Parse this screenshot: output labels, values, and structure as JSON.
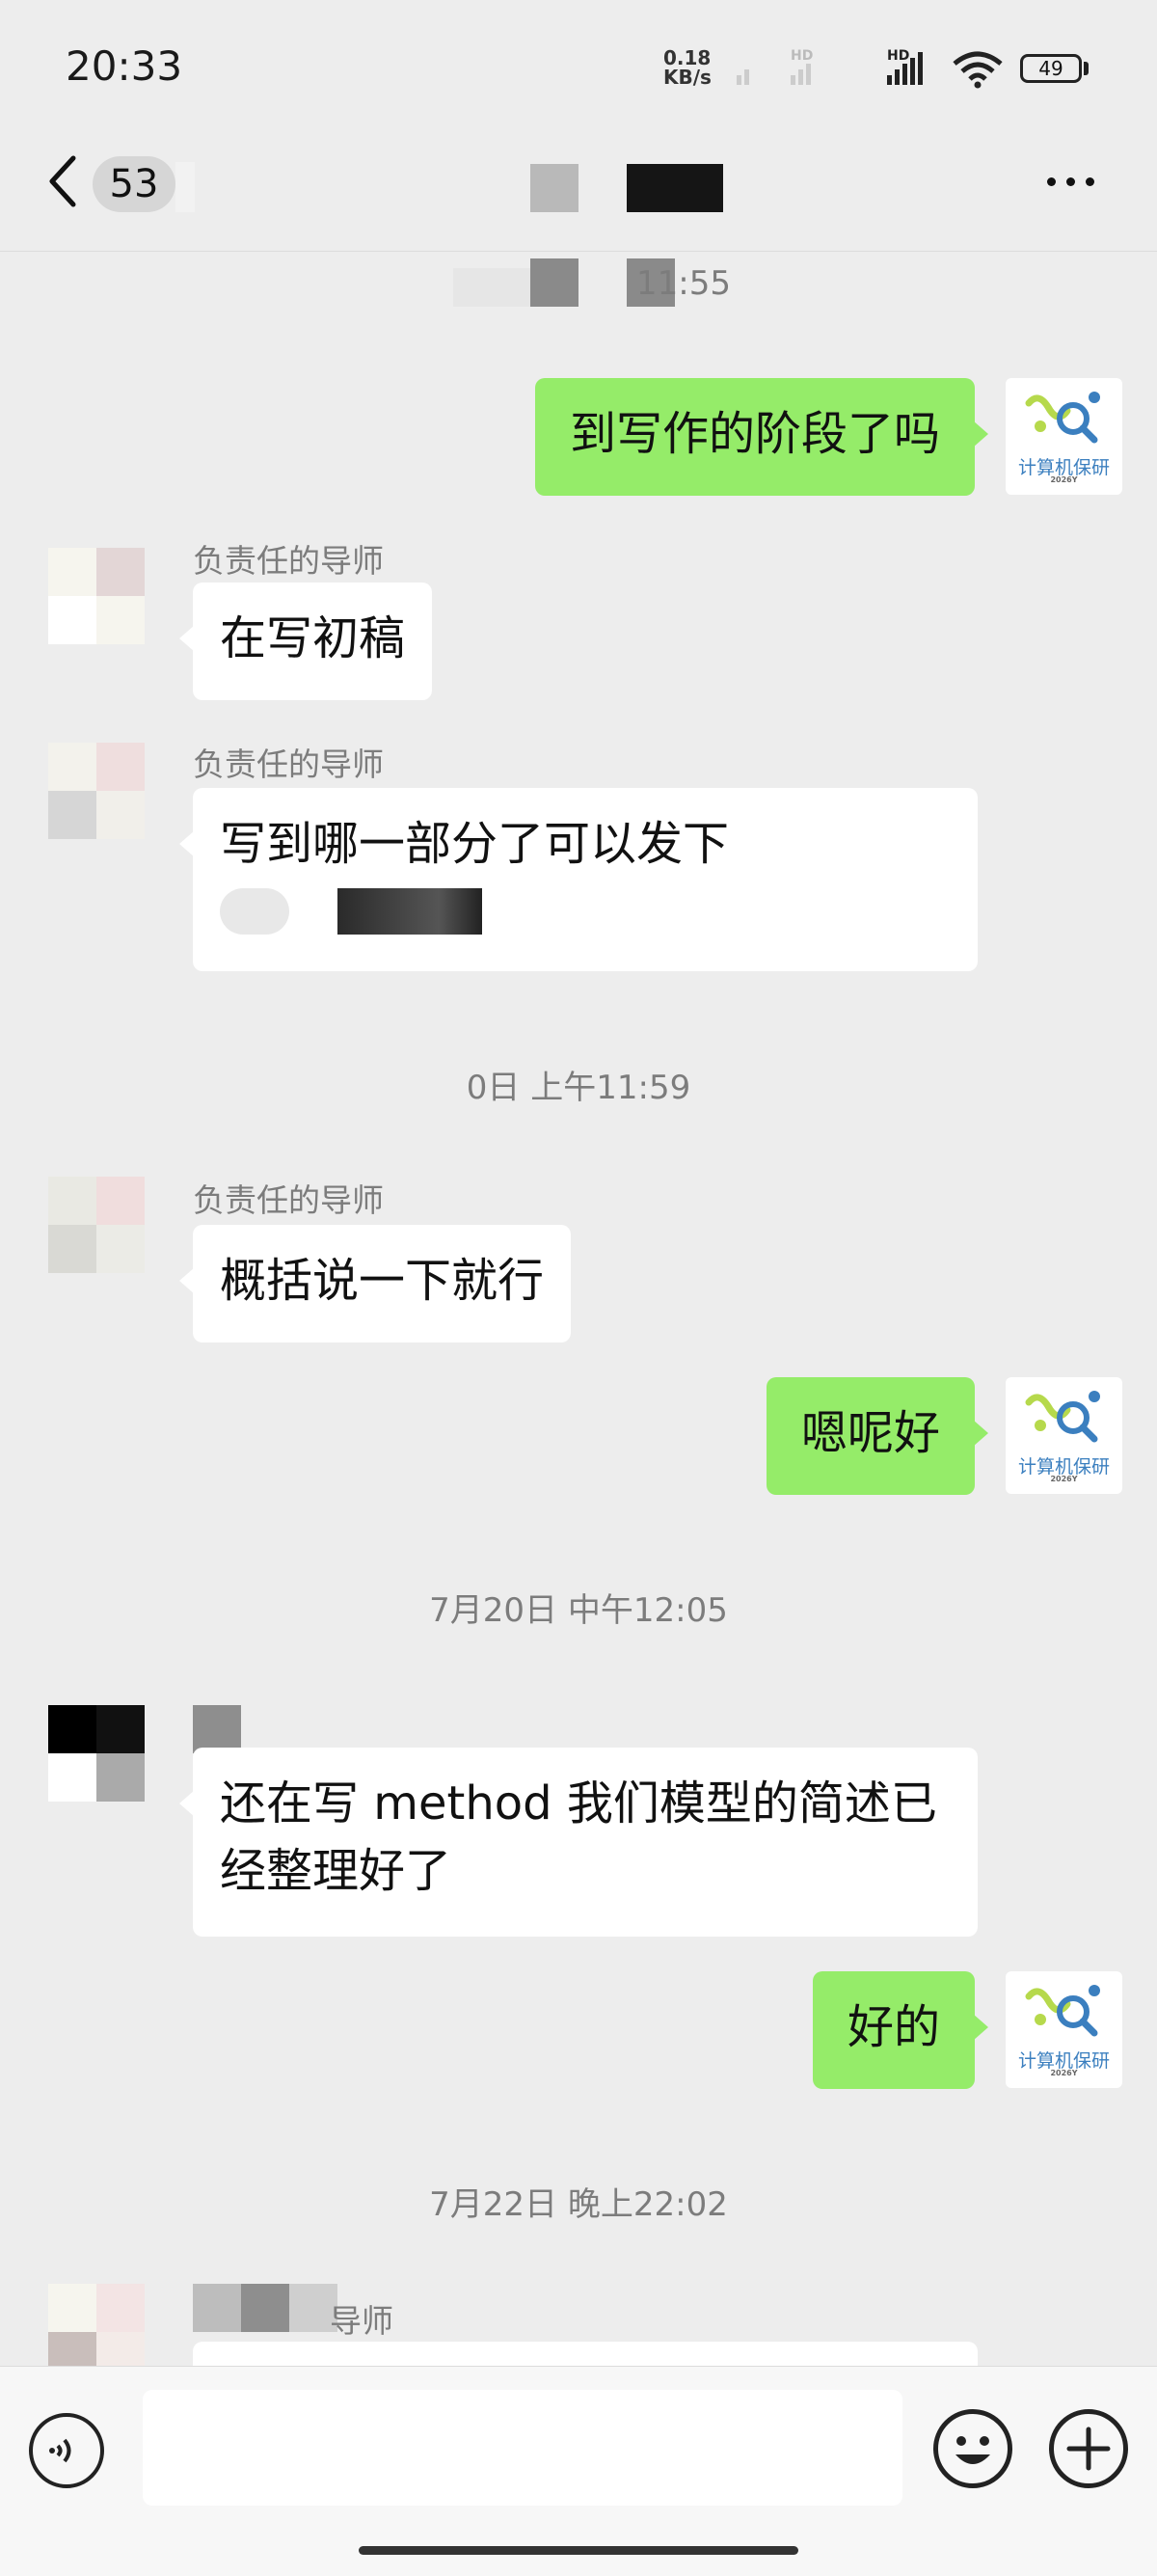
{
  "status_bar": {
    "time": "20:33",
    "net_speed_value": "0.18",
    "net_speed_unit": "KB/s",
    "hd1": "HD",
    "hd2": "HD",
    "battery": "49"
  },
  "nav": {
    "unread_count": "53"
  },
  "messages": [
    {
      "time_partial": "11:55"
    },
    {
      "me": "到写作的阶段了吗"
    },
    {
      "sender": "负责任的导师",
      "text": "在写初稿"
    },
    {
      "sender": "负责任的导师",
      "text": "写到哪一部分了可以发下"
    },
    {
      "time_partial": "0日 上午11:59"
    },
    {
      "sender": "负责任的导师",
      "text": "概括说一下就行"
    },
    {
      "me": "嗯呢好"
    },
    {
      "time": "7月20日 中午12:05"
    },
    {
      "text_line1": "还在写 method 我们模型的简述已",
      "text_line2": "经整理好了"
    },
    {
      "me": "好的"
    },
    {
      "time": "7月22日 晚上22:02"
    },
    {
      "sender_partial": "导师"
    }
  ],
  "avatar": {
    "self_label": "计算机保研",
    "self_sub": "2026Y"
  }
}
